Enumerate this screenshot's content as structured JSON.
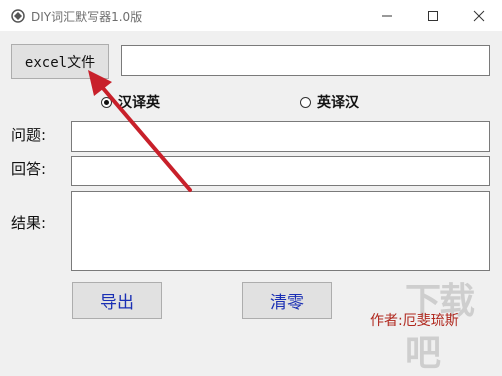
{
  "window": {
    "title": "DIY词汇默写器1.0版"
  },
  "buttons": {
    "excel": "excel文件",
    "export": "导出",
    "clear": "清零"
  },
  "fields": {
    "path": "",
    "question": "",
    "answer": "",
    "result": ""
  },
  "labels": {
    "question": "问题:",
    "answer": "回答:",
    "result": "结果:"
  },
  "radios": [
    {
      "label": "汉译英",
      "checked": true
    },
    {
      "label": "英译汉",
      "checked": false
    }
  ],
  "footer": {
    "author": "作者:厄斐琉斯",
    "watermark": "下载吧"
  },
  "colors": {
    "arrow": "#c8202a",
    "button_text": "#1a2fb4",
    "author_text": "#b0281e"
  }
}
